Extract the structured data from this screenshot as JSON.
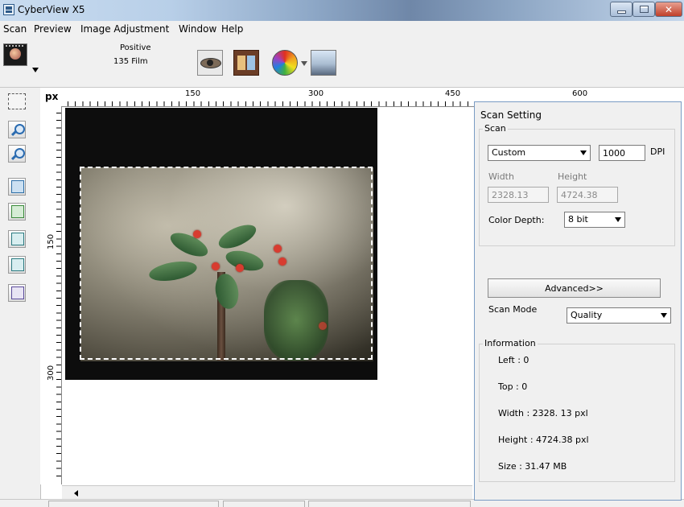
{
  "window": {
    "title": "CyberView X5"
  },
  "menu": [
    "Scan",
    "Preview",
    "Image Adjustment",
    "Window",
    "Help"
  ],
  "toolbar": {
    "mode_line1": "Positive",
    "mode_line2": "135 Film"
  },
  "ruler": {
    "unit": "px",
    "h_ticks": [
      "150",
      "300",
      "450",
      "600"
    ],
    "v_ticks": [
      "150",
      "300"
    ]
  },
  "scan_panel": {
    "title": "Scan Setting",
    "scan_group": "Scan",
    "resolution_preset": "Custom",
    "dpi_value": "1000",
    "dpi_unit": "DPI",
    "width_label": "Width",
    "height_label": "Height",
    "width_value": "2328.13",
    "height_value": "4724.38",
    "color_depth_label": "Color Depth:",
    "color_depth_value": "8 bit",
    "advanced_label": "Advanced>>",
    "scan_mode_label": "Scan Mode",
    "scan_mode_value": "Quality",
    "info_group": "Information",
    "info_left": "Left : 0",
    "info_top": "Top : 0",
    "info_width": "Width : 2328. 13 pxl",
    "info_height": "Height : 4724.38 pxl",
    "info_size": "Size : 31.47 MB"
  },
  "colors": {
    "titlebar": "#8fa9c8",
    "panel_bg": "#f0f0f0",
    "close_button": "#c0402a",
    "preview_bg": "#0d0d0d"
  }
}
